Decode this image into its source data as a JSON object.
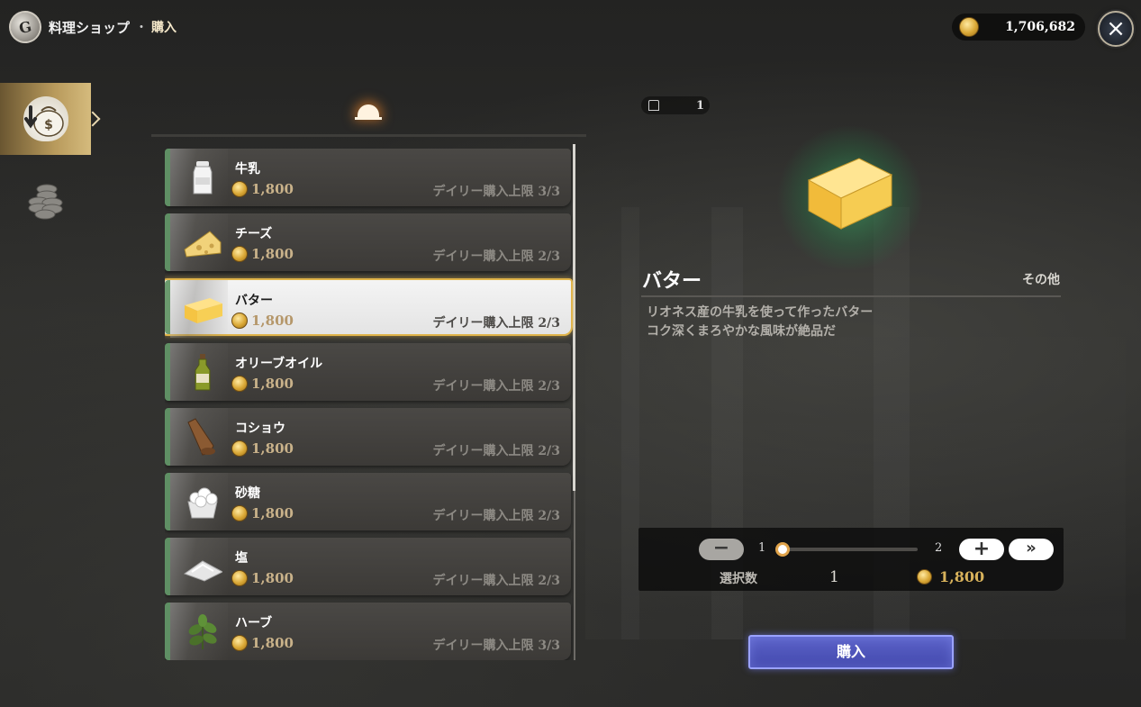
{
  "header": {
    "title": "料理ショップ",
    "separator": "・",
    "subtitle": "購入",
    "logo_letter": "G"
  },
  "currency": {
    "value": "1,706,682",
    "icon": "gold-coin-icon"
  },
  "close_icon": "×",
  "nav": {
    "tabs": [
      {
        "icon": "buy-bag-icon",
        "active": true
      },
      {
        "icon": "coin-stack-icon",
        "active": false
      }
    ]
  },
  "list_header_icon": "cloche-icon",
  "items": [
    {
      "name": "牛乳",
      "price": "1,800",
      "limit_label": "デイリー購入上限",
      "limit": "3/3",
      "icon": "milk-bottle-icon"
    },
    {
      "name": "チーズ",
      "price": "1,800",
      "limit_label": "デイリー購入上限",
      "limit": "2/3",
      "icon": "cheese-icon"
    },
    {
      "name": "バター",
      "price": "1,800",
      "limit_label": "デイリー購入上限",
      "limit": "2/3",
      "icon": "butter-icon",
      "selected": true
    },
    {
      "name": "オリーブオイル",
      "price": "1,800",
      "limit_label": "デイリー購入上限",
      "limit": "2/3",
      "icon": "olive-oil-icon"
    },
    {
      "name": "コショウ",
      "price": "1,800",
      "limit_label": "デイリー購入上限",
      "limit": "2/3",
      "icon": "pepper-mill-icon"
    },
    {
      "name": "砂糖",
      "price": "1,800",
      "limit_label": "デイリー購入上限",
      "limit": "2/3",
      "icon": "sugar-icon"
    },
    {
      "name": "塩",
      "price": "1,800",
      "limit_label": "デイリー購入上限",
      "limit": "2/3",
      "icon": "salt-icon"
    },
    {
      "name": "ハーブ",
      "price": "1,800",
      "limit_label": "デイリー購入上限",
      "limit": "3/3",
      "icon": "herb-icon"
    }
  ],
  "detail": {
    "owned_count": "1",
    "name": "バター",
    "category": "その他",
    "description_line1": "リオネス産の牛乳を使って作ったバター",
    "description_line2": "コク深くまろやかな風味が絶品だ"
  },
  "quantity": {
    "min": "1",
    "max": "2",
    "minus_label": "−",
    "plus_label": "+",
    "max_label": "»",
    "selected_label": "選択数",
    "selected_value": "1",
    "total_price": "1,800",
    "slider_fraction": 0.0
  },
  "buy_button": "購入",
  "colors": {
    "accent_gold": "#e0b44a",
    "buy_button": "#4f56bd",
    "item_stripe": "#5f8f64"
  }
}
